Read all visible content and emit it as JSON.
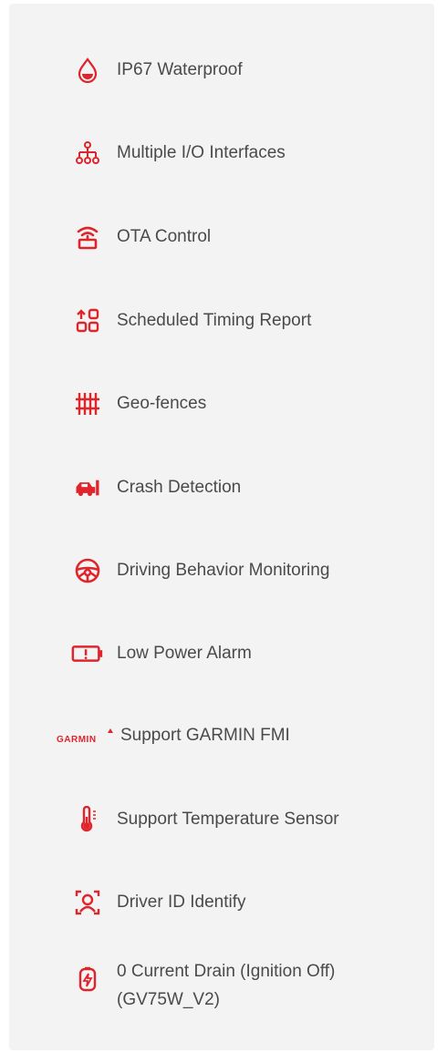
{
  "accent_color": "#e0242c",
  "text_color": "#4a4a4a",
  "features": [
    {
      "icon": "water-drop-icon",
      "label": "IP67 Waterproof"
    },
    {
      "icon": "network-hierarchy-icon",
      "label": "Multiple I/O Interfaces"
    },
    {
      "icon": "wireless-router-icon",
      "label": "OTA Control"
    },
    {
      "icon": "schedule-grid-icon",
      "label": "Scheduled Timing Report"
    },
    {
      "icon": "fence-icon",
      "label": "Geo-fences"
    },
    {
      "icon": "car-crash-icon",
      "label": "Crash Detection"
    },
    {
      "icon": "steering-wheel-icon",
      "label": "Driving Behavior Monitoring"
    },
    {
      "icon": "low-battery-icon",
      "label": "Low Power Alarm"
    },
    {
      "icon": "garmin-logo-icon",
      "label": "Support GARMIN FMI",
      "logo_text": "GARMIN"
    },
    {
      "icon": "thermometer-icon",
      "label": "Support Temperature Sensor"
    },
    {
      "icon": "face-scan-icon",
      "label": "Driver ID Identify"
    },
    {
      "icon": "battery-bolt-icon",
      "label_line1": "0 Current Drain (Ignition Off)",
      "label_line2": "(GV75W_V2)"
    }
  ]
}
